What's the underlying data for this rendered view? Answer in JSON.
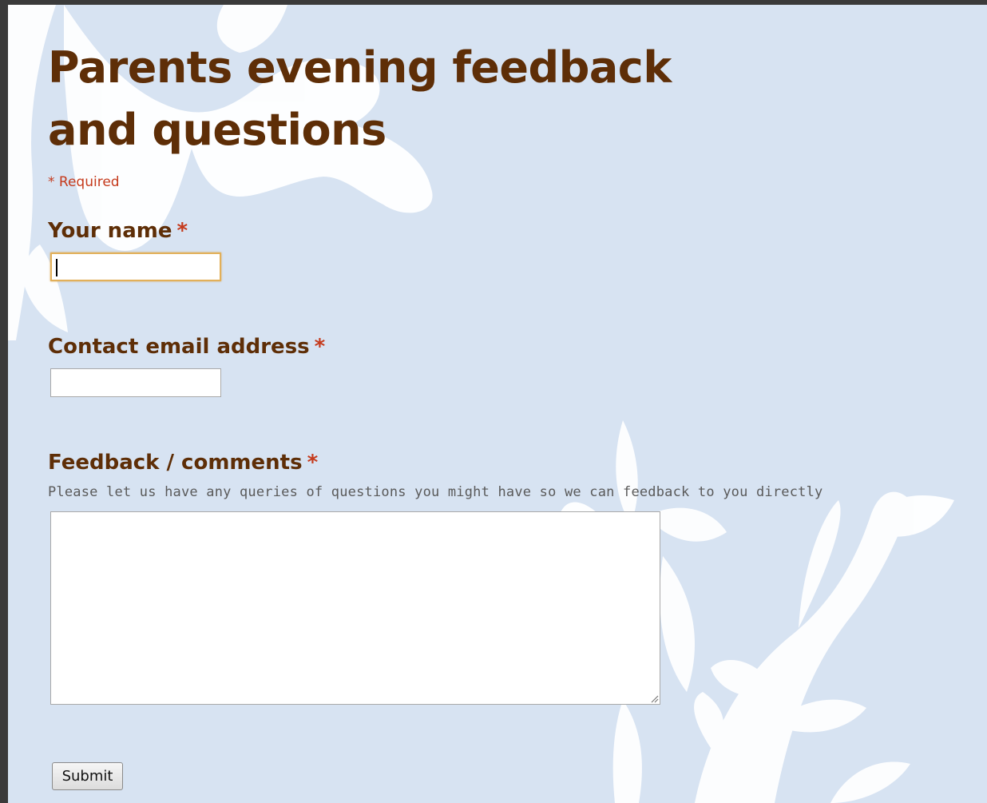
{
  "form": {
    "title": "Parents evening feedback and questions",
    "required_note": "* Required",
    "fields": [
      {
        "label": "Your name",
        "required_marker": "*",
        "value": ""
      },
      {
        "label": "Contact email address",
        "required_marker": "*",
        "value": ""
      },
      {
        "label": "Feedback / comments",
        "required_marker": "*",
        "help_text": "Please let us have any queries of questions you might have so we can feedback to you directly",
        "value": ""
      }
    ],
    "submit_label": "Submit"
  },
  "colors": {
    "background": "#d7e3f2",
    "heading": "#5e2e07",
    "required": "#c53a1c",
    "focus_border": "#e2b05a"
  }
}
